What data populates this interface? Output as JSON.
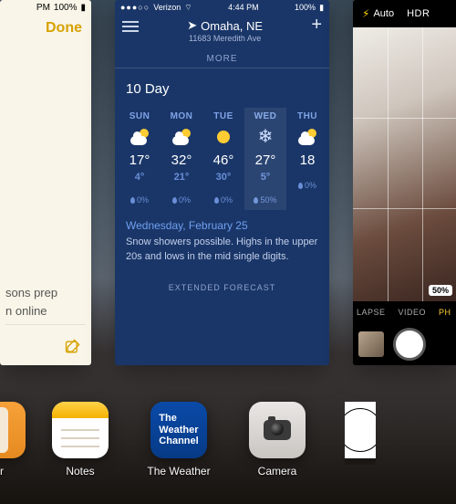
{
  "notes": {
    "status_time_suffix": "PM",
    "status_pct": "100%",
    "done": "Done",
    "line1": "sons prep",
    "line2": "n online"
  },
  "weather": {
    "carrier": "Verizon",
    "time": "4:44 PM",
    "battery": "100%",
    "city": "Omaha, NE",
    "address": "11683 Meredith Ave",
    "more": "MORE",
    "heading": "10 Day",
    "days": [
      {
        "name": "SUN",
        "icon": "suncloud",
        "hi": "17°",
        "lo": "4°",
        "precip": "0%",
        "selected": false
      },
      {
        "name": "MON",
        "icon": "suncloud",
        "hi": "32°",
        "lo": "21°",
        "precip": "0%",
        "selected": false
      },
      {
        "name": "TUE",
        "icon": "sun",
        "hi": "46°",
        "lo": "30°",
        "precip": "0%",
        "selected": false
      },
      {
        "name": "WED",
        "icon": "snow",
        "hi": "27°",
        "lo": "5°",
        "precip": "50%",
        "selected": true
      },
      {
        "name": "THU",
        "icon": "suncloud",
        "hi": "18",
        "lo": "",
        "precip": "0%",
        "selected": false
      }
    ],
    "selected_date": "Wednesday, February 25",
    "selected_desc": "Snow showers possible. Highs in the upper 20s and lows in the mid single digits.",
    "extended": "EXTENDED FORECAST"
  },
  "camera": {
    "flash_mode": "Auto",
    "hdr": "HDR",
    "zoom_badge": "50%",
    "modes": {
      "lapse": "LAPSE",
      "video": "VIDEO",
      "photo": "PH"
    }
  },
  "dock": {
    "calc": {
      "label": "tor"
    },
    "notes": {
      "label": "Notes"
    },
    "twc": {
      "label": "The Weather",
      "tile_text": "The\nWeather\nChannel"
    },
    "cam": {
      "label": "Camera"
    },
    "clock": {
      "label": ""
    }
  }
}
